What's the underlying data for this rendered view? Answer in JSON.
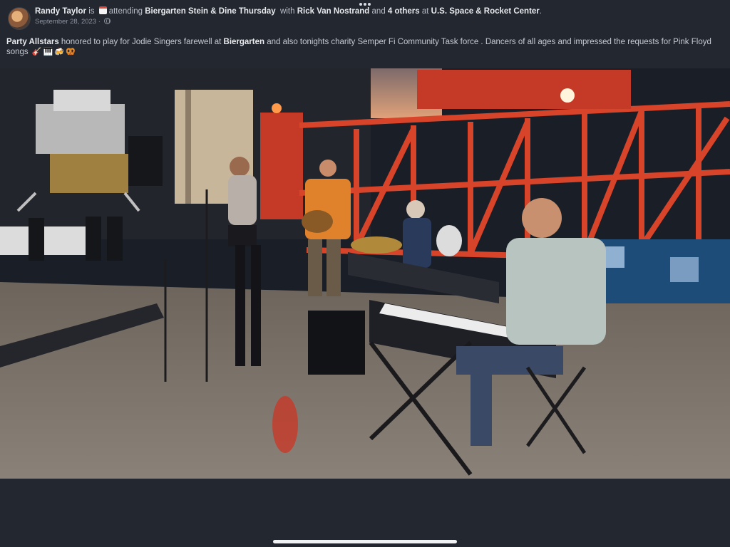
{
  "post": {
    "author": "Randy Taylor",
    "is_text": "is",
    "activity": "attending",
    "event": "Biergarten Stein & Dine Thursday",
    "with_text": "with",
    "tagged_person": "Rick Van Nostrand",
    "and_text": "and",
    "others": "4 others",
    "at_text": "at",
    "location": "U.S. Space & Rocket Center",
    "date": "September 28, 2023",
    "date_separator": "·",
    "caption": {
      "part1": "Party Allstars",
      "part2": " honored to play for Jodie Singers farewell at ",
      "part3": "Biergarten",
      "part4": " and also tonights charity Semper Fi Community Task force . Dancers of all ages and impressed the requests for Pink Floyd songs "
    }
  },
  "icons": {
    "emojis": [
      "🎸",
      "🎹",
      "🍻",
      "🥨"
    ]
  },
  "colors": {
    "background": "#23272f",
    "text": "#cfd3da",
    "truss_red": "#d8442a"
  }
}
